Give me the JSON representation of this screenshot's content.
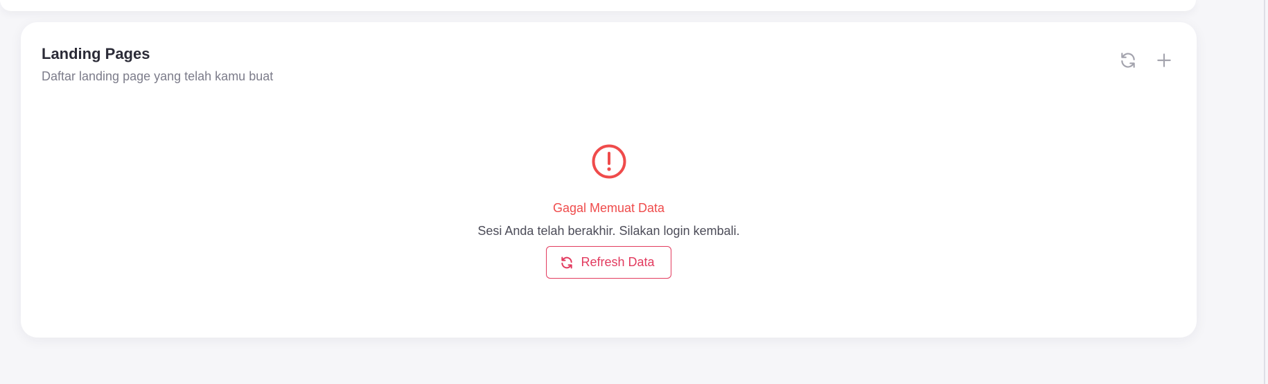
{
  "card": {
    "title": "Landing Pages",
    "subtitle": "Daftar landing page yang telah kamu buat",
    "actions": [
      {
        "icon": "refresh-icon"
      },
      {
        "icon": "plus-icon"
      }
    ]
  },
  "error": {
    "icon": "alert-circle-icon",
    "title": "Gagal Memuat Data",
    "message": "Sesi Anda telah berakhir. Silakan login kembali.",
    "button_label": "Refresh Data",
    "button_icon": "refresh-icon"
  },
  "colors": {
    "error": "#ef4b4b",
    "button_accent": "#e23a5e",
    "icon_muted": "#a3a3ad",
    "background": "#f6f6f9",
    "card": "#ffffff"
  }
}
